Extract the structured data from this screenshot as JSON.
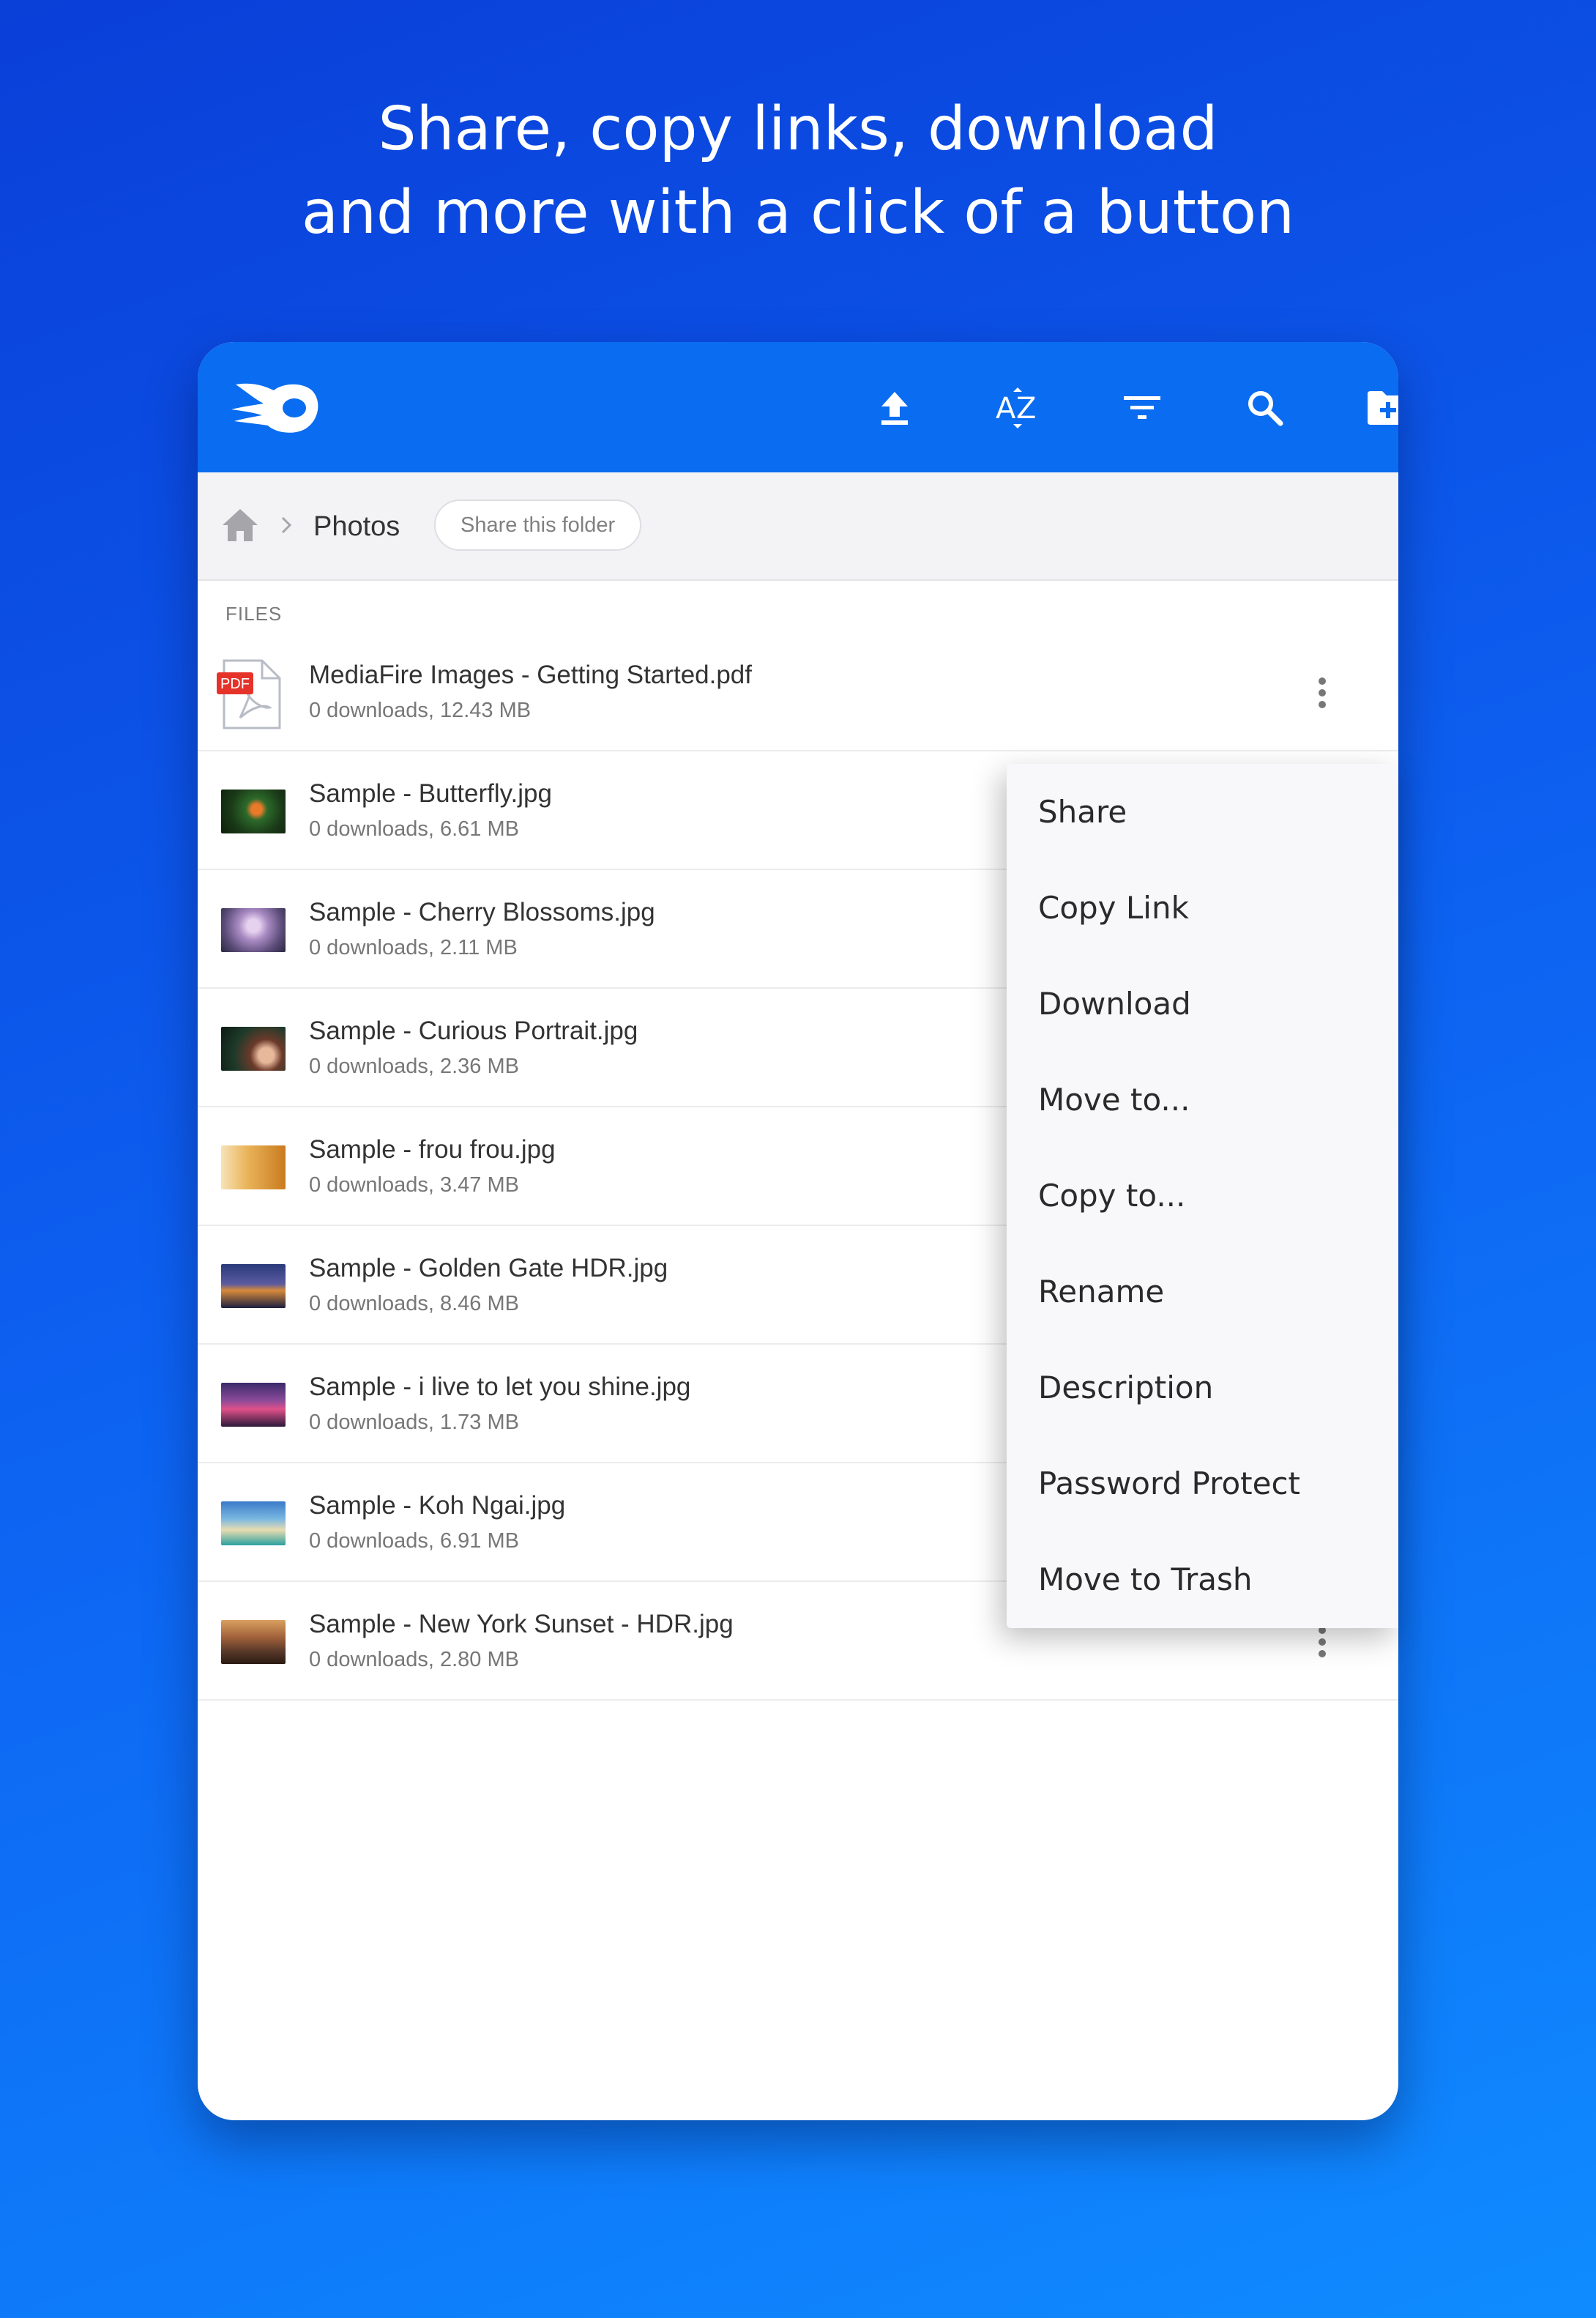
{
  "headline": {
    "line1": "Share, copy links, download",
    "line2": "and more with a click of a button"
  },
  "toolbar": {
    "logo": "mediafire-logo",
    "icons": [
      "upload-icon",
      "sort-az-icon",
      "filter-icon",
      "search-icon",
      "new-folder-icon",
      "menu-icon"
    ],
    "color": "#0a6cf0"
  },
  "breadcrumb": {
    "home_icon": "home-icon",
    "current": "Photos",
    "share_button": "Share this folder"
  },
  "files_section": {
    "label": "FILES",
    "files": [
      {
        "name": "MediaFire Images - Getting Started.pdf",
        "meta": "0 downloads, 12.43 MB",
        "type": "pdf",
        "pdf_badge": "PDF"
      },
      {
        "name": "Sample - Butterfly.jpg",
        "meta": "0 downloads, 6.61 MB",
        "type": "image"
      },
      {
        "name": "Sample - Cherry Blossoms.jpg",
        "meta": "0 downloads, 2.11 MB",
        "type": "image"
      },
      {
        "name": "Sample - Curious Portrait.jpg",
        "meta": "0 downloads, 2.36 MB",
        "type": "image"
      },
      {
        "name": "Sample - frou frou.jpg",
        "meta": "0 downloads, 3.47 MB",
        "type": "image"
      },
      {
        "name": "Sample - Golden Gate HDR.jpg",
        "meta": "0 downloads, 8.46 MB",
        "type": "image"
      },
      {
        "name": "Sample - i live to let you shine.jpg",
        "meta": "0 downloads, 1.73 MB",
        "type": "image"
      },
      {
        "name": "Sample - Koh Ngai.jpg",
        "meta": "0 downloads, 6.91 MB",
        "type": "image"
      },
      {
        "name": "Sample - New York Sunset - HDR.jpg",
        "meta": "0 downloads, 2.80 MB",
        "type": "image"
      }
    ]
  },
  "context_menu": {
    "items": [
      "Share",
      "Copy Link",
      "Download",
      "Move to...",
      "Copy to...",
      "Rename",
      "Description",
      "Password Protect",
      "Move to Trash"
    ]
  }
}
